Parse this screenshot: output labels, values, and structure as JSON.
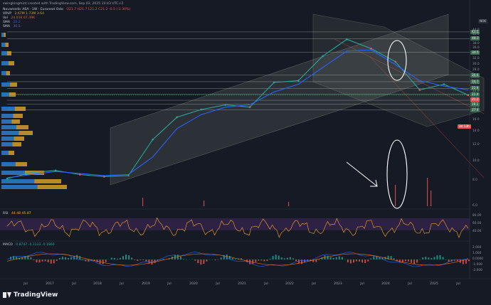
{
  "header": {
    "watermark": "swingkingmint created with TradingView.com, Sep 03, 2025 10:43 UTC+2",
    "symbol": "Navamedic ASA · 1W · Euronext Oslo",
    "ohlc": "O21.7 H21.7 L21.2 C21.2 -0.5 (-2.30%)",
    "vrvp_label": "VRVP",
    "vrvp_values": "2.67M 1.73M 3.64",
    "vol_label": "Vol",
    "vol_values": "24.01K 67.49K",
    "sma1_label": "SMA",
    "sma1_value": "25.2",
    "sma2_label": "SMA",
    "sma2_value": "30.5"
  },
  "rsi": {
    "label": "RSI",
    "values": "44.48 45.87",
    "ticks": [
      "80.00",
      "60.00",
      "40.00"
    ]
  },
  "macd": {
    "label": "MACD",
    "values": "0.8747 -0.1133 -0.1869",
    "ticks": [
      "2.000",
      "1.000",
      "0.0000",
      "-1.000",
      "-2.000"
    ]
  },
  "currency": "NOK",
  "last_price_tag": "21.2",
  "countdown_tag": "3d 13h",
  "level_tags": [
    "43.5",
    "40.3",
    "34.5",
    "26.6",
    "24.7",
    "22.9",
    "21.4",
    "20.0",
    "19.1",
    "17.9"
  ],
  "x_labels": [
    "Jul",
    "2017",
    "Jul",
    "2018",
    "Jul",
    "2019",
    "Jul",
    "2020",
    "Jul",
    "2021",
    "Jul",
    "2022",
    "Jul",
    "2023",
    "Jul",
    "2024",
    "Jul",
    "2025",
    "Jul"
  ],
  "brand": "TradingView",
  "colors": {
    "bg": "#161a25",
    "up": "#26a69a",
    "down": "#ef5350",
    "sma": "#2962ff",
    "rsi_line": "#ffa726",
    "rsi_band": "#4a2a6a",
    "vp_a": "#2a7fd4",
    "vp_b": "#d4a02a",
    "level": "#c8e6c9"
  },
  "chart_data": {
    "type": "line",
    "title": "",
    "y_scale": "log",
    "ylim": [
      6,
      46
    ],
    "y_ticks": [
      6,
      8,
      10,
      12,
      14,
      16,
      18,
      20,
      22,
      24,
      26,
      28,
      30,
      32,
      34,
      36,
      38,
      40,
      42,
      44
    ],
    "x": [
      "2016-07",
      "2017-01",
      "2017-07",
      "2018-01",
      "2018-07",
      "2019-01",
      "2019-07",
      "2020-01",
      "2020-07",
      "2021-01",
      "2021-07",
      "2022-01",
      "2022-07",
      "2023-01",
      "2023-07",
      "2024-01",
      "2024-07",
      "2025-01",
      "2025-07",
      "2025-09"
    ],
    "series": [
      {
        "values": [
          8.2,
          8.8,
          9.0,
          8.6,
          8.4,
          8.5,
          12.8,
          16.5,
          18.0,
          19.0,
          18.5,
          24.5,
          25.0,
          33.0,
          40.0,
          36.0,
          31.0,
          22.5,
          24.0,
          21.2
        ]
      },
      {
        "values": [
          8.3,
          8.6,
          8.9,
          8.7,
          8.5,
          8.6,
          10.5,
          14.5,
          17.0,
          18.5,
          19.0,
          22.0,
          24.0,
          29.0,
          35.0,
          35.5,
          30.0,
          25.0,
          23.5,
          22.5
        ]
      }
    ],
    "horizontal_levels": [
      43.5,
      40.3,
      34.5,
      26.6,
      24.7,
      22.9,
      21.4,
      20.0,
      19.1,
      17.9
    ]
  }
}
